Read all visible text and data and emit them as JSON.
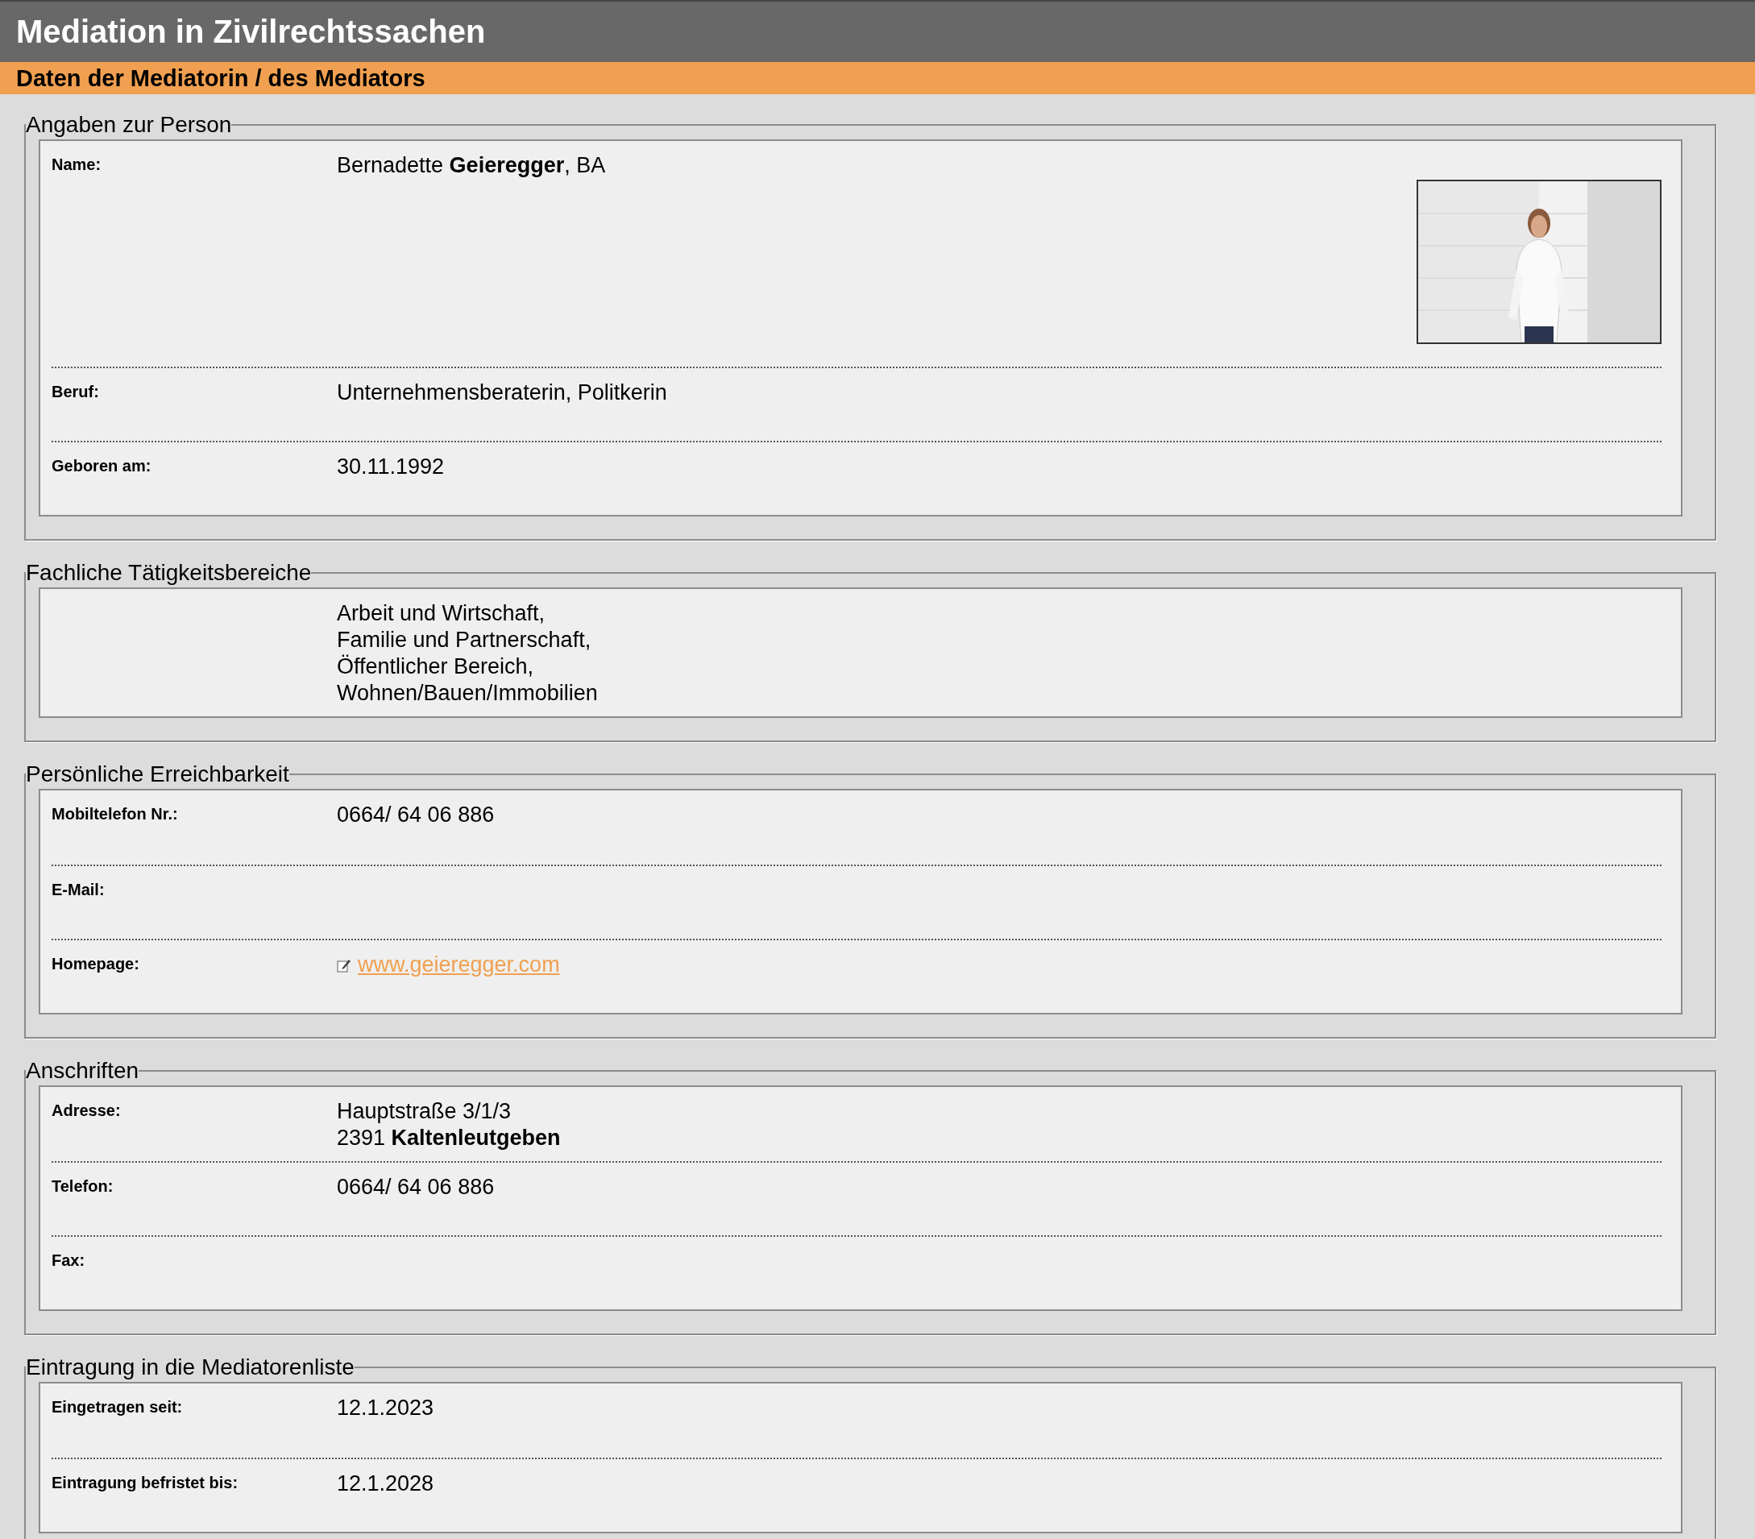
{
  "title": "Mediation in Zivilrechtssachen",
  "subtitle": "Daten der Mediatorin / des Mediators",
  "sections": [
    {
      "legend": "Angaben zur Person",
      "rows": [
        {
          "label": "Name:",
          "lines": [
            "Bernadette **Geieregger**, BA"
          ]
        },
        {
          "kind": "text",
          "label": "Beruf:",
          "lines": [
            "Unternehmensberaterin, Politkerin"
          ]
        },
        {
          "kind": "text",
          "label": "Geboren am:",
          "lines": [
            "30.11.1992"
          ]
        }
      ]
    },
    {
      "legend": "Fachliche Tätigkeitsbereiche",
      "rows": [
        {
          "kind": "text",
          "lines": [
            "Arbeit und Wirtschaft,",
            "Familie und Partnerschaft,",
            "Öffentlicher Bereich,",
            "Wohnen/Bauen/Immobilien"
          ]
        }
      ]
    },
    {
      "legend": "Persönliche Erreichbarkeit",
      "rows": [
        {
          "kind": "text",
          "label": "Mobiltelefon Nr.:",
          "lines": [
            "0664/ 64 06 886"
          ]
        },
        {
          "kind": "text",
          "label": "E-Mail:"
        },
        {
          "kind": "link",
          "label": "Homepage:",
          "lines": [
            "www.geieregger.com"
          ]
        }
      ]
    },
    {
      "legend": "Anschriften",
      "rows": [
        {
          "kind": "text",
          "label": "Adresse:",
          "lines": [
            "Hauptstraße 3/1/3",
            "2391 **Kaltenleutgeben**"
          ]
        },
        {
          "kind": "text",
          "label": "Telefon:",
          "lines": [
            "0664/ 64 06 886"
          ]
        },
        {
          "kind": "text",
          "label": "Fax:"
        }
      ]
    },
    {
      "legend": "Eintragung in die Mediatorenliste",
      "rows": [
        {
          "kind": "text",
          "label": "Eingetragen seit:",
          "lines": [
            "12.1.2023"
          ]
        },
        {
          "kind": "text",
          "label": "Eintragung befristet bis:",
          "lines": [
            "12.1.2028"
          ]
        }
      ]
    }
  ]
}
